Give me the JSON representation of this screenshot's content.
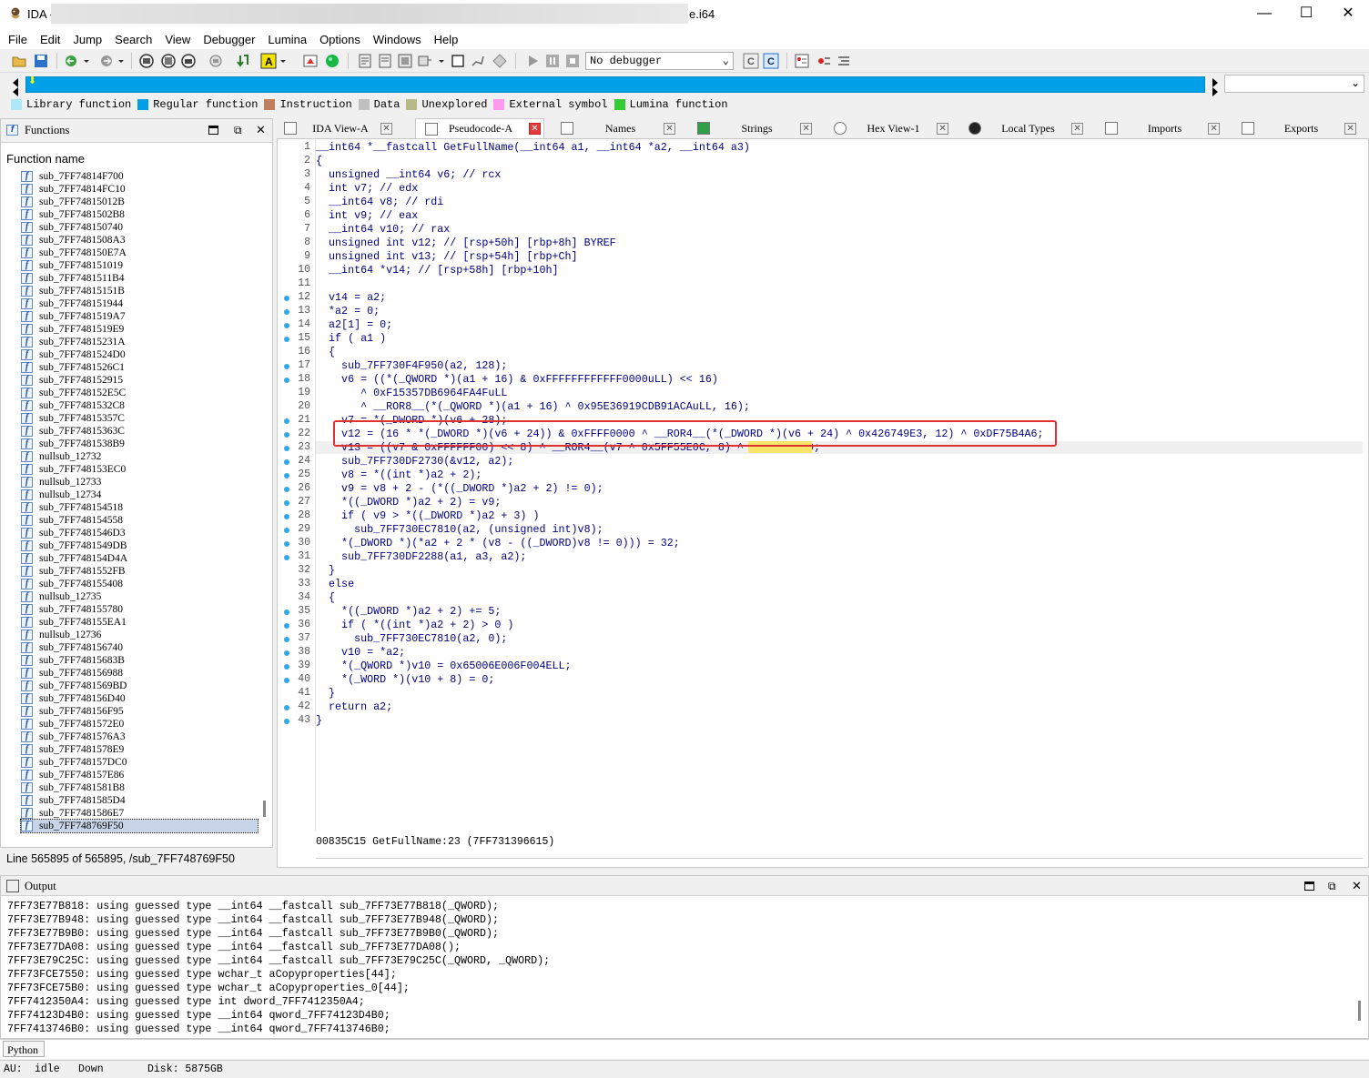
{
  "window": {
    "app_title": "IDA -",
    "title_suffix": "e.i64",
    "minimize": "—",
    "maximize": "☐",
    "close": "✕"
  },
  "menu": [
    "File",
    "Edit",
    "Jump",
    "Search",
    "View",
    "Debugger",
    "Lumina",
    "Options",
    "Windows",
    "Help"
  ],
  "toolbar": {
    "debugger_select": "No debugger"
  },
  "legend": [
    {
      "label": "Library function",
      "color": "#aee8f8"
    },
    {
      "label": "Regular function",
      "color": "#00a0e9"
    },
    {
      "label": "Instruction",
      "color": "#c08060"
    },
    {
      "label": "Data",
      "color": "#c0c0c0"
    },
    {
      "label": "Unexplored",
      "color": "#b8b888"
    },
    {
      "label": "External symbol",
      "color": "#ff99ee"
    },
    {
      "label": "Lumina function",
      "color": "#33cc33"
    }
  ],
  "functions_panel": {
    "title": "Functions",
    "column_header": "Function name",
    "items": [
      "sub_7FF74814F700",
      "sub_7FF74814FC10",
      "sub_7FF74815012B",
      "sub_7FF7481502B8",
      "sub_7FF748150740",
      "sub_7FF7481508A3",
      "sub_7FF748150E7A",
      "sub_7FF748151019",
      "sub_7FF7481511B4",
      "sub_7FF74815151B",
      "sub_7FF748151944",
      "sub_7FF7481519A7",
      "sub_7FF7481519E9",
      "sub_7FF74815231A",
      "sub_7FF7481524D0",
      "sub_7FF7481526C1",
      "sub_7FF748152915",
      "sub_7FF748152E5C",
      "sub_7FF7481532C8",
      "sub_7FF74815357C",
      "sub_7FF74815363C",
      "sub_7FF7481538B9",
      "nullsub_12732",
      "sub_7FF748153EC0",
      "nullsub_12733",
      "nullsub_12734",
      "sub_7FF748154518",
      "sub_7FF748154558",
      "sub_7FF7481546D3",
      "sub_7FF7481549DB",
      "sub_7FF748154D4A",
      "sub_7FF7481552FB",
      "sub_7FF748155408",
      "nullsub_12735",
      "sub_7FF748155780",
      "sub_7FF748155EA1",
      "nullsub_12736",
      "sub_7FF748156740",
      "sub_7FF74815683B",
      "sub_7FF748156988",
      "sub_7FF7481569BD",
      "sub_7FF748156D40",
      "sub_7FF748156F95",
      "sub_7FF7481572E0",
      "sub_7FF7481576A3",
      "sub_7FF7481578E9",
      "sub_7FF748157DC0",
      "sub_7FF748157E86",
      "sub_7FF7481581B8",
      "sub_7FF7481585D4",
      "sub_7FF7481586E7",
      "sub_7FF748769F50"
    ],
    "status": "Line 565895 of 565895, /sub_7FF748769F50"
  },
  "tabs": [
    "IDA View-A",
    "Pseudocode-A",
    "Names",
    "Strings",
    "Hex View-1",
    "Local Types",
    "Imports",
    "Exports"
  ],
  "code": {
    "lines": [
      "__int64 *__fastcall GetFullName(__int64 a1, __int64 *a2, __int64 a3)",
      "{",
      "  unsigned __int64 v6; // rcx",
      "  int v7; // edx",
      "  __int64 v8; // rdi",
      "  int v9; // eax",
      "  __int64 v10; // rax",
      "  unsigned int v12; // [rsp+50h] [rbp+8h] BYREF",
      "  unsigned int v13; // [rsp+54h] [rbp+Ch]",
      "  __int64 *v14; // [rsp+58h] [rbp+10h]",
      "",
      "  v14 = a2;",
      "  *a2 = 0;",
      "  a2[1] = 0;",
      "  if ( a1 )",
      "  {",
      "    sub_7FF730F4F950(a2, 128);",
      "    v6 = ((*(_QWORD *)(a1 + 16) & 0xFFFFFFFFFFFF0000uLL) << 16)",
      "       ^ 0xF15357DB6964FA4FuLL",
      "       ^ __ROR8__(*(_QWORD *)(a1 + 16) ^ 0x95E36919CDB91ACAuLL, 16);",
      "    v7 = *(_DWORD *)(v6 + 28);",
      "    v12 = (16 * *(_DWORD *)(v6 + 24)) & 0xFFFF0000 ^ __ROR4__(*(_DWORD *)(v6 + 24) ^ 0x426749E3, 12) ^ 0xDF75B4A6;",
      "    v13 = ((v7 & 0xFFFFFF00) << 8) ^ __ROR4__(v7 ^ 0x5FF55E0C, 8) ^ 0x715578CD;",
      "    sub_7FF730DF2730(&v12, a2);",
      "    v8 = *((int *)a2 + 2);",
      "    v9 = v8 + 2 - (*((_DWORD *)a2 + 2) != 0);",
      "    *((_DWORD *)a2 + 2) = v9;",
      "    if ( v9 > *((_DWORD *)a2 + 3) )",
      "      sub_7FF730EC7810(a2, (unsigned int)v8);",
      "    *(_DWORD *)(*a2 + 2 * (v8 - ((_DWORD)v8 != 0))) = 32;",
      "    sub_7FF730DF2288(a1, a3, a2);",
      "  }",
      "  else",
      "  {",
      "    *((_DWORD *)a2 + 2) += 5;",
      "    if ( *((int *)a2 + 2) > 0 )",
      "      sub_7FF730EC7810(a2, 0);",
      "    v10 = *a2;",
      "    *(_QWORD *)v10 = 0x65006E006F004ELL;",
      "    *(_WORD *)(v10 + 8) = 0;",
      "  }",
      "  return a2;",
      "}"
    ],
    "breakpoint_lines": [
      12,
      13,
      14,
      15,
      17,
      18,
      21,
      22,
      23,
      24,
      25,
      26,
      27,
      28,
      29,
      30,
      31,
      35,
      36,
      37,
      38,
      39,
      40,
      42,
      43
    ],
    "status_address": "00835C15",
    "status_location": "GetFullName:23 (7FF731396615)"
  },
  "output_panel": {
    "title": "Output",
    "lines": [
      "7FF73E77B818: using guessed type __int64 __fastcall sub_7FF73E77B818(_QWORD);",
      "7FF73E77B948: using guessed type __int64 __fastcall sub_7FF73E77B948(_QWORD);",
      "7FF73E77B9B0: using guessed type __int64 __fastcall sub_7FF73E77B9B0(_QWORD);",
      "7FF73E77DA08: using guessed type __int64 __fastcall sub_7FF73E77DA08();",
      "7FF73E79C25C: using guessed type __int64 __fastcall sub_7FF73E79C25C(_QWORD, _QWORD);",
      "7FF73FCE7550: using guessed type wchar_t aCopyproperties[44];",
      "7FF73FCE75B0: using guessed type wchar_t aCopyproperties_0[44];",
      "7FF7412350A4: using guessed type int dword_7FF7412350A4;",
      "7FF74123D4B0: using guessed type __int64 qword_7FF74123D4B0;",
      "7FF7413746B0: using guessed type __int64 qword_7FF7413746B0;"
    ],
    "python_button": "Python"
  },
  "statusbar": {
    "au_label": "AU:",
    "au_state": "idle",
    "direction": "Down",
    "disk": "Disk: 5875GB"
  }
}
